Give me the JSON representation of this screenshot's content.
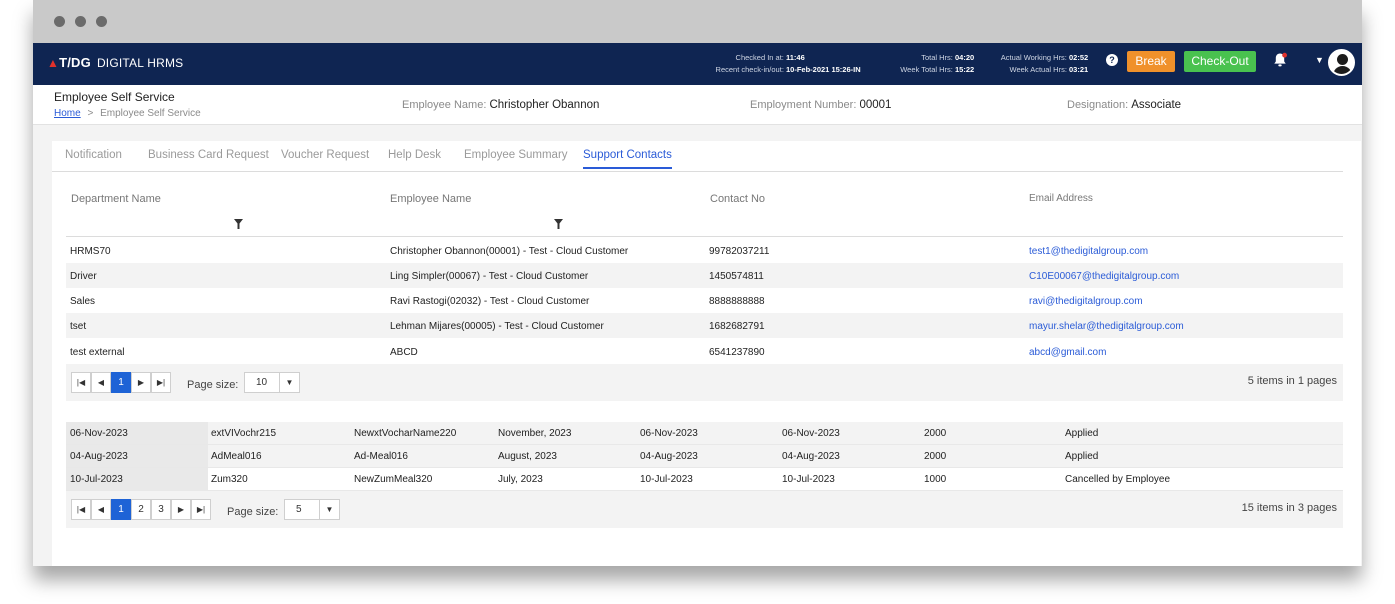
{
  "app": {
    "brand": "T/DG",
    "product": "DIGITAL HRMS"
  },
  "status": {
    "checked_in_label": "Checked In at:",
    "checked_in_value": "11:46",
    "recent_label": "Recent check-in/out:",
    "recent_value": "10-Feb-2021 15:26-IN",
    "total_hrs_label": "Total Hrs:",
    "total_hrs_value": "04:20",
    "week_total_label": "Week Total Hrs:",
    "week_total_value": "15:22",
    "actual_label": "Actual Working Hrs:",
    "actual_value": "02:52",
    "week_actual_label": "Week Actual Hrs:",
    "week_actual_value": "03:21"
  },
  "actions": {
    "help": "?",
    "break": "Break",
    "checkout": "Check-Out"
  },
  "page": {
    "title": "Employee Self Service",
    "breadcrumb_home": "Home",
    "breadcrumb_sep": ">",
    "breadcrumb_current": "Employee Self Service",
    "employee_name_label": "Employee Name:",
    "employee_name": "Christopher Obannon",
    "employment_number_label": "Employment Number:",
    "employment_number": "00001",
    "designation_label": "Designation:",
    "designation": "Associate"
  },
  "tabs": [
    {
      "label": "Notification"
    },
    {
      "label": "Business Card Request"
    },
    {
      "label": "Voucher Request"
    },
    {
      "label": "Help Desk"
    },
    {
      "label": "Employee Summary"
    },
    {
      "label": "Support Contacts",
      "active": true
    }
  ],
  "contacts": {
    "headers": [
      "Department Name",
      "Employee Name",
      "Contact No",
      "Email Address"
    ],
    "rows": [
      [
        "HRMS70",
        "Christopher Obannon(00001) - Test - Cloud Customer",
        "99782037211",
        "test1@thedigitalgroup.com"
      ],
      [
        "Driver",
        "Ling Simpler(00067) - Test - Cloud Customer",
        "1450574811",
        "C10E00067@thedigitalgroup.com"
      ],
      [
        "Sales",
        "Ravi Rastogi(02032) - Test - Cloud Customer",
        "8888888888",
        "ravi@thedigitalgroup.com"
      ],
      [
        "tset",
        "Lehman Mijares(00005) - Test - Cloud Customer",
        "1682682791",
        "mayur.shelar@thedigitalgroup.com"
      ],
      [
        "test external",
        "ABCD",
        "6541237890",
        "abcd@gmail.com"
      ]
    ],
    "pager": {
      "current_page": "1",
      "page_size_label": "Page size:",
      "page_size": "10",
      "summary": "5 items in 1 pages"
    }
  },
  "vouchers": {
    "rows": [
      [
        "06-Nov-2023",
        "extVIVochr215",
        "NewxtVocharName220",
        "November, 2023",
        "06-Nov-2023",
        "06-Nov-2023",
        "2000",
        "Applied"
      ],
      [
        "04-Aug-2023",
        "AdMeal016",
        "Ad-Meal016",
        "August, 2023",
        "04-Aug-2023",
        "04-Aug-2023",
        "2000",
        "Applied"
      ],
      [
        "10-Jul-2023",
        "Zum320",
        "NewZumMeal320",
        "July, 2023",
        "10-Jul-2023",
        "10-Jul-2023",
        "1000",
        "Cancelled by Employee"
      ]
    ],
    "pager": {
      "pages": [
        "1",
        "2",
        "3"
      ],
      "page_size_label": "Page size:",
      "page_size": "5",
      "summary": "15 items in 3 pages"
    }
  },
  "icons": {
    "first": "first-page-icon",
    "prev": "prev-page-icon",
    "next": "next-page-icon",
    "last": "last-page-icon",
    "filter": "filter-icon",
    "bell": "bell-icon",
    "dropdown": "chevron-down-icon"
  },
  "colors": {
    "topbar": "#0f2552",
    "break": "#f0912b",
    "checkout": "#49c24f",
    "accent": "#2a5bd7"
  }
}
